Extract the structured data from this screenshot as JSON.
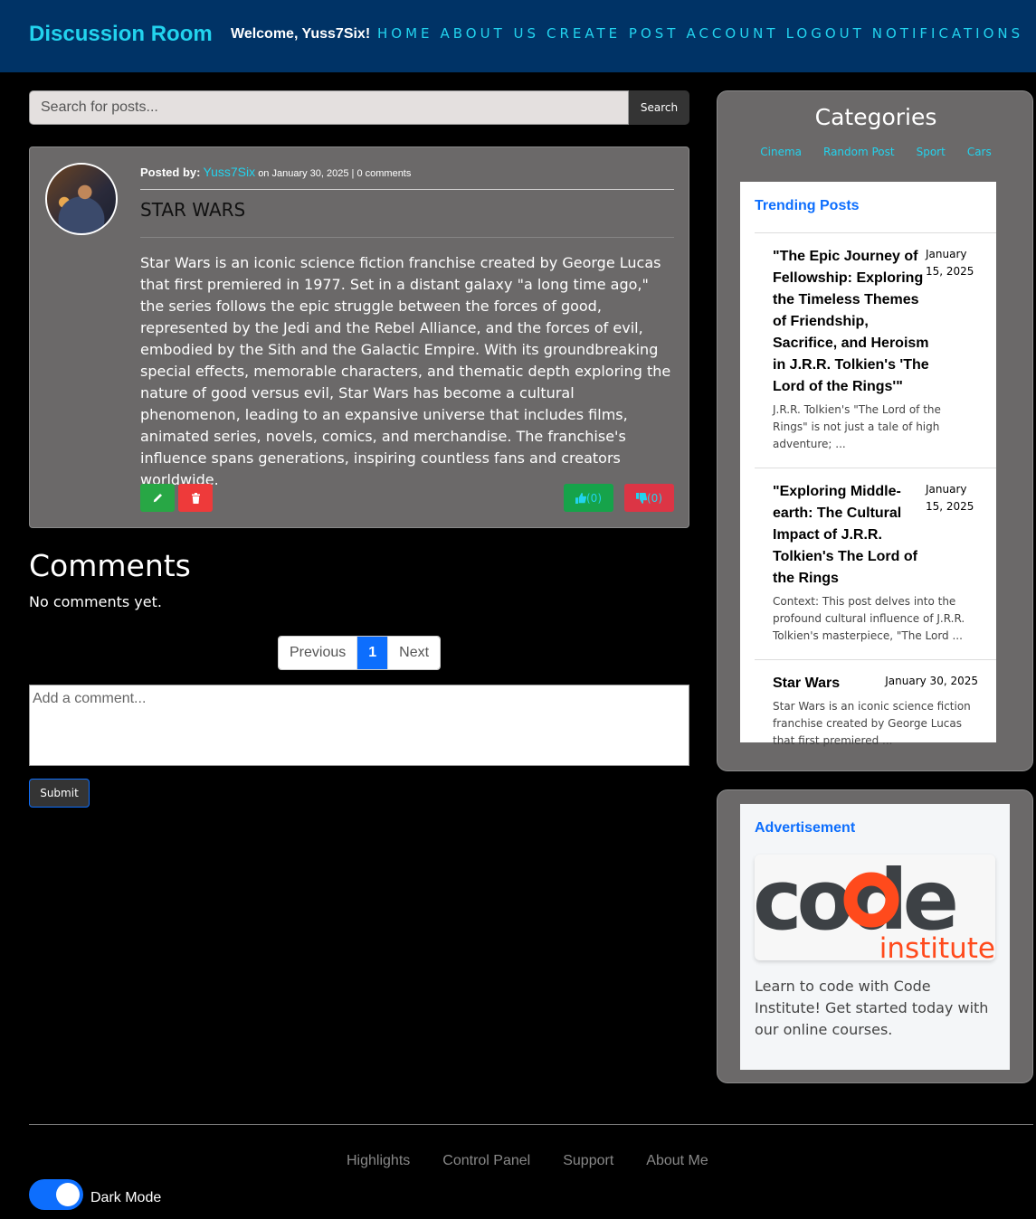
{
  "navbar": {
    "brand": "Discussion Room",
    "welcome": "Welcome, Yuss7Six!",
    "links": [
      "HOME",
      "ABOUT US",
      "CREATE POST",
      "ACCOUNT",
      "LOGOUT",
      "NOTIFICATIONS"
    ]
  },
  "search": {
    "placeholder": "Search for posts...",
    "button_label": "Search"
  },
  "post": {
    "posted_by_label": "Posted by:",
    "author": "Yuss7Six",
    "meta_suffix": "on January 30, 2025 | 0 comments",
    "title": "STAR WARS",
    "body": "Star Wars is an iconic science fiction franchise created by George Lucas that first premiered in 1977. Set in a distant galaxy \"a long time ago,\" the series follows the epic struggle between the forces of good, represented by the Jedi and the Rebel Alliance, and the forces of evil, embodied by the Sith and the Galactic Empire. With its groundbreaking special effects, memorable characters, and thematic depth exploring the nature of good versus evil, Star Wars has become a cultural phenomenon, leading to an expansive universe that includes films, animated series, novels, comics, and merchandise. The franchise's influence spans generations, inspiring countless fans and creators worldwide.",
    "likes": "(0)",
    "dislikes": "(0)"
  },
  "comments": {
    "title": "Comments",
    "empty_text": "No comments yet.",
    "pagination": {
      "previous": "Previous",
      "current": "1",
      "next": "Next"
    },
    "input_placeholder": "Add a comment...",
    "submit_label": "Submit"
  },
  "categories": {
    "title": "Categories",
    "items": [
      "Cinema",
      "Random Post",
      "Sport",
      "Cars"
    ]
  },
  "trending": {
    "heading": "Trending Posts",
    "items": [
      {
        "title": "\"The Epic Journey of Fellowship: Exploring the Timeless Themes of Friendship, Sacrifice, and Heroism in J.R.R. Tolkien's 'The Lord of the Rings'\"",
        "date": "January 15, 2025",
        "excerpt": "J.R.R. Tolkien's \"The Lord of the Rings\" is not just a tale of high adventure; ..."
      },
      {
        "title": "\"Exploring Middle-earth: The Cultural Impact of J.R.R. Tolkien's The Lord of the Rings",
        "date": "January 15, 2025",
        "excerpt": "Context: This post delves into the profound cultural influence of J.R.R. Tolkien's masterpiece, \"The Lord ..."
      },
      {
        "title": "Star Wars",
        "date": "January 30, 2025",
        "excerpt": "Star Wars is an iconic science fiction franchise created by George Lucas that first premiered ..."
      }
    ]
  },
  "advertisement": {
    "heading": "Advertisement",
    "logo_word": "code",
    "logo_sub": "institute",
    "text": "Learn to code with Code Institute! Get started today with our online courses."
  },
  "footer": {
    "links": [
      "Highlights",
      "Control Panel",
      "Support",
      "About Me"
    ],
    "dark_mode_label": "Dark Mode",
    "dark_mode_on": true
  },
  "colors": {
    "navbar": "#003366",
    "accent_cyan": "#22d3ee",
    "primary_blue": "#0d6efd",
    "card_gray": "#6b6969"
  }
}
